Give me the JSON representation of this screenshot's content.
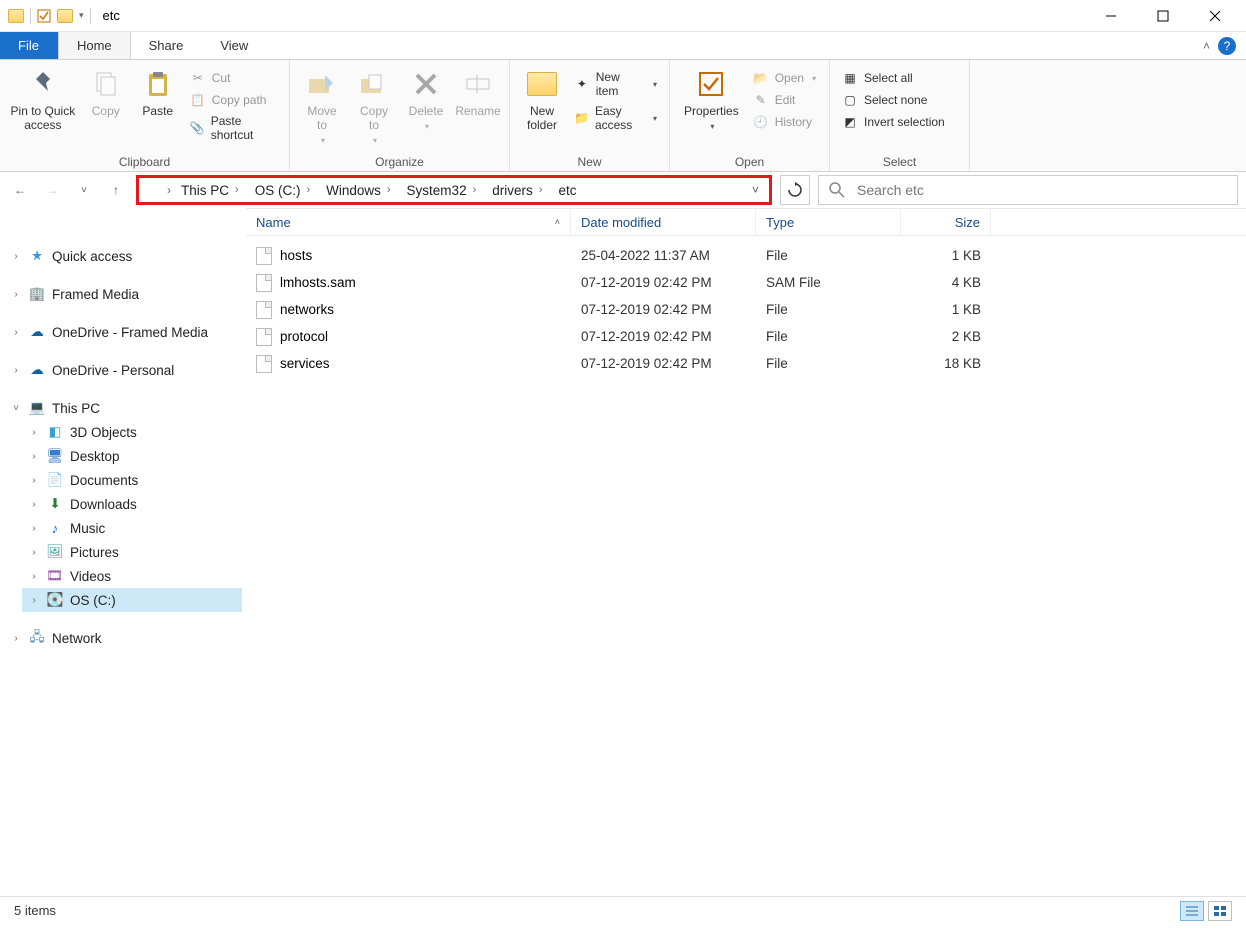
{
  "window": {
    "title": "etc"
  },
  "tabs": {
    "file": "File",
    "home": "Home",
    "share": "Share",
    "view": "View"
  },
  "ribbon": {
    "clipboard": {
      "label": "Clipboard",
      "pin": "Pin to Quick\naccess",
      "copy": "Copy",
      "paste": "Paste",
      "cut": "Cut",
      "copy_path": "Copy path",
      "paste_shortcut": "Paste shortcut"
    },
    "organize": {
      "label": "Organize",
      "move_to": "Move\nto",
      "copy_to": "Copy\nto",
      "delete": "Delete",
      "rename": "Rename"
    },
    "new": {
      "label": "New",
      "new_folder": "New\nfolder",
      "new_item": "New item",
      "easy_access": "Easy access"
    },
    "open": {
      "label": "Open",
      "properties": "Properties",
      "open": "Open",
      "edit": "Edit",
      "history": "History"
    },
    "select": {
      "label": "Select",
      "select_all": "Select all",
      "select_none": "Select none",
      "invert": "Invert selection"
    }
  },
  "breadcrumb": [
    "This PC",
    "OS (C:)",
    "Windows",
    "System32",
    "drivers",
    "etc"
  ],
  "search": {
    "placeholder": "Search etc"
  },
  "columns": {
    "name": "Name",
    "date": "Date modified",
    "type": "Type",
    "size": "Size"
  },
  "tree": {
    "quick_access": "Quick access",
    "framed_media": "Framed Media",
    "onedrive_fm": "OneDrive - Framed Media",
    "onedrive_p": "OneDrive - Personal",
    "this_pc": "This PC",
    "pc_children": [
      "3D Objects",
      "Desktop",
      "Documents",
      "Downloads",
      "Music",
      "Pictures",
      "Videos",
      "OS (C:)"
    ],
    "network": "Network"
  },
  "files": [
    {
      "name": "hosts",
      "date": "25-04-2022 11:37 AM",
      "type": "File",
      "size": "1 KB"
    },
    {
      "name": "lmhosts.sam",
      "date": "07-12-2019 02:42 PM",
      "type": "SAM File",
      "size": "4 KB"
    },
    {
      "name": "networks",
      "date": "07-12-2019 02:42 PM",
      "type": "File",
      "size": "1 KB"
    },
    {
      "name": "protocol",
      "date": "07-12-2019 02:42 PM",
      "type": "File",
      "size": "2 KB"
    },
    {
      "name": "services",
      "date": "07-12-2019 02:42 PM",
      "type": "File",
      "size": "18 KB"
    }
  ],
  "status": {
    "count": "5 items"
  }
}
